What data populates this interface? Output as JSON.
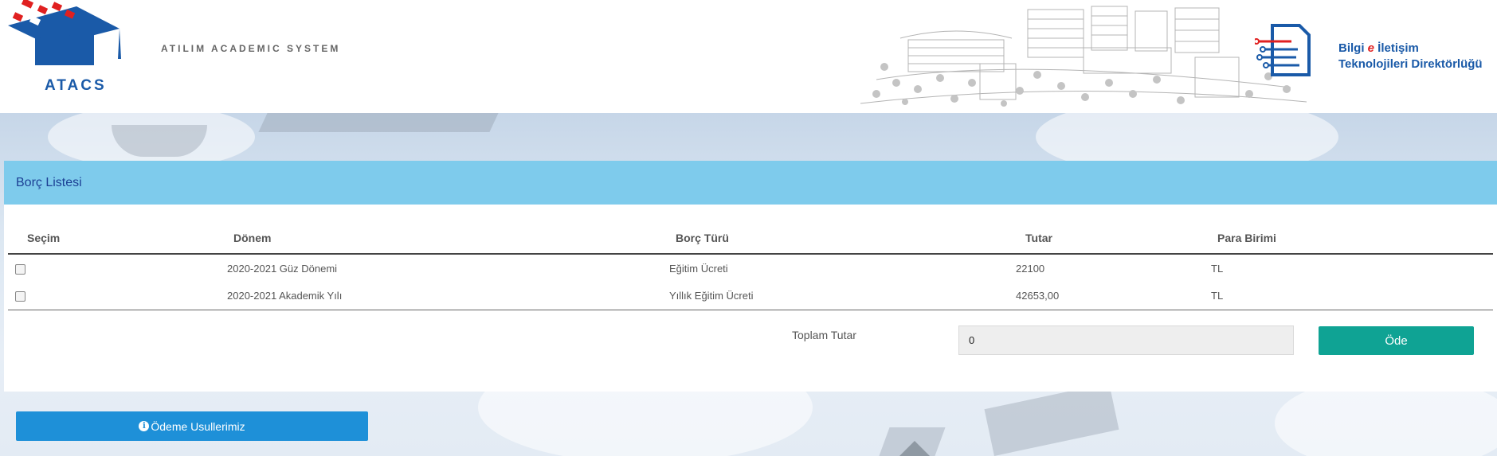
{
  "header": {
    "logo_text": "ATACS",
    "system_name": "ATILIM ACADEMIC SYSTEM",
    "bidb_line1_a": "Bilgi ",
    "bidb_line1_e": "e",
    "bidb_line1_b": " İletişim",
    "bidb_line2": "Teknolojileri Direktörlüğü"
  },
  "panel": {
    "title": "Borç Listesi"
  },
  "table": {
    "columns": [
      "Seçim",
      "Dönem",
      "Borç Türü",
      "Tutar",
      "Para Birimi"
    ],
    "rows": [
      {
        "donem": "2020-2021 Güz Dönemi",
        "tur": "Eğitim Ücreti",
        "tutar": "22100",
        "birim": "TL"
      },
      {
        "donem": "2020-2021 Akademik Yılı",
        "tur": "Yıllık Eğitim Ücreti",
        "tutar": "42653,00",
        "birim": "TL"
      }
    ]
  },
  "total": {
    "label": "Toplam Tutar",
    "value": "0"
  },
  "buttons": {
    "pay": "Öde",
    "methods": "Ödeme Usullerimiz"
  },
  "colors": {
    "panel_header": "#7ecbec",
    "pay_button": "#0fa394",
    "methods_button": "#1e90d8",
    "title_text": "#1c3f94",
    "brand_blue": "#1a5aa8",
    "brand_red": "#e02020"
  },
  "icons": {
    "graduation_cap": "graduation-cap-icon",
    "bidb": "circuit-document-icon",
    "info": "info-circle-icon"
  }
}
